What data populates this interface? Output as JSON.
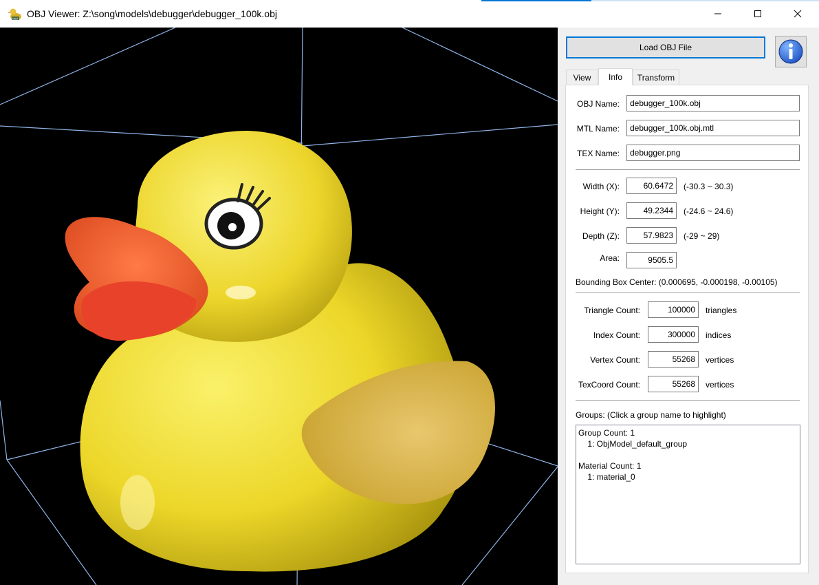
{
  "window": {
    "title": "OBJ Viewer: Z:\\song\\models\\debugger\\debugger_100k.obj",
    "app_icon": "rubber-duck-icon",
    "controls": [
      "minimize-icon",
      "maximize-icon",
      "close-icon"
    ]
  },
  "toolbar": {
    "load_label": "Load OBJ File",
    "info_icon": "info-icon"
  },
  "tabs": [
    {
      "label": "View",
      "active": false
    },
    {
      "label": "Info",
      "active": true
    },
    {
      "label": "Transform",
      "active": false
    }
  ],
  "info": {
    "obj_name_label": "OBJ Name:",
    "obj_name": "debugger_100k.obj",
    "mtl_name_label": "MTL Name:",
    "mtl_name": "debugger_100k.obj.mtl",
    "tex_name_label": "TEX Name:",
    "tex_name": "debugger.png",
    "width_label": "Width (X):",
    "width": "60.6472",
    "width_range": "(-30.3 ~ 30.3)",
    "height_label": "Height (Y):",
    "height": "49.2344",
    "height_range": "(-24.6 ~ 24.6)",
    "depth_label": "Depth (Z):",
    "depth": "57.9823",
    "depth_range": "(-29 ~ 29)",
    "area_label": "Area:",
    "area": "9505.5",
    "bbox_center": "Bounding Box Center: (0.000695, -0.000198, -0.00105)",
    "triangle_label": "Triangle Count:",
    "triangle_count": "100000",
    "triangle_unit": "triangles",
    "index_label": "Index Count:",
    "index_count": "300000",
    "index_unit": "indices",
    "vertex_label": "Vertex Count:",
    "vertex_count": "55268",
    "vertex_unit": "vertices",
    "texcoord_label": "TexCoord Count:",
    "texcoord_count": "55268",
    "texcoord_unit": "vertices",
    "groups_label": "Groups: (Click a group name to highlight)",
    "groups_text": "Group Count: 1\n    1: ObjModel_default_group\n\nMaterial Count: 1\n    1: material_0"
  },
  "colors": {
    "accent": "#0078d7",
    "viewport_bg": "#000000",
    "bbox_lines": "#8fb4e6",
    "duck_yellow": "#f2e02a",
    "beak_orange": "#f0602a"
  }
}
